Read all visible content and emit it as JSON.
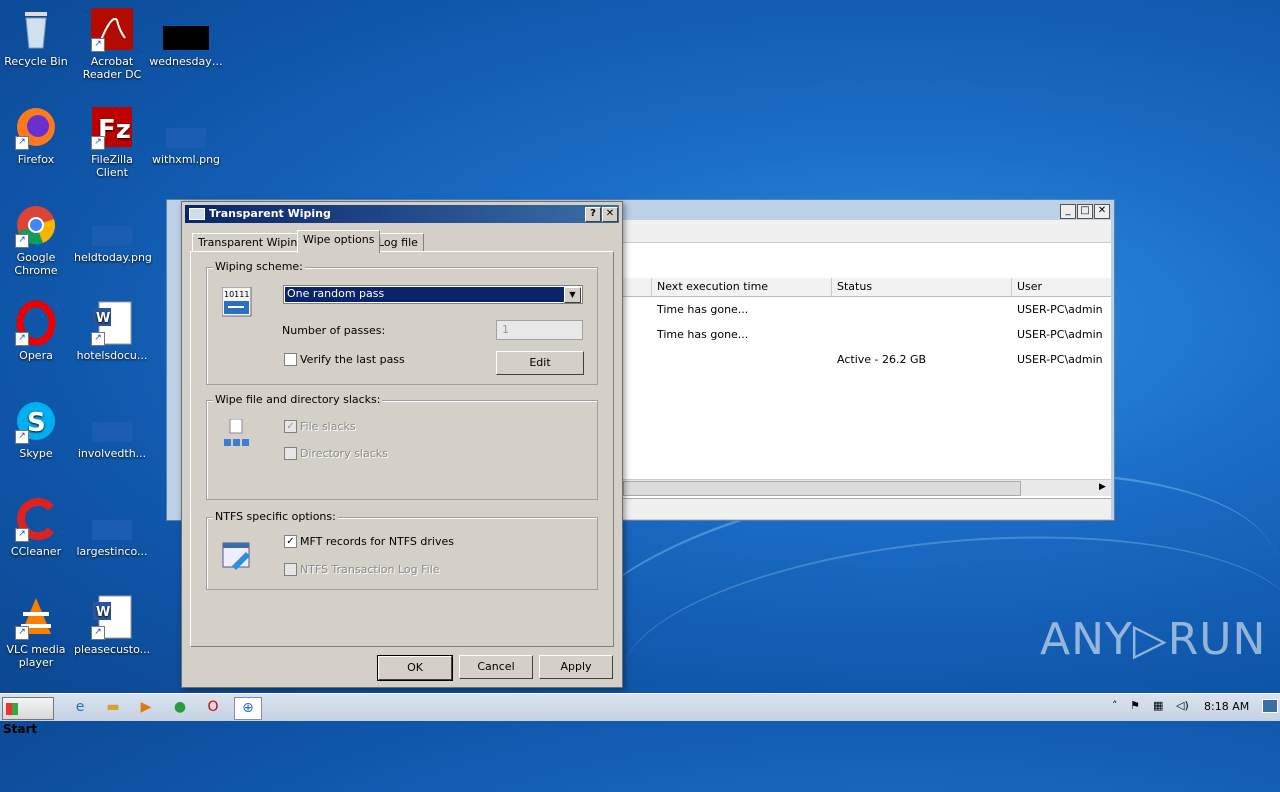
{
  "desktop": {
    "icons": [
      {
        "label": "Recycle Bin",
        "icon": "recycle-bin-icon"
      },
      {
        "label": "Acrobat Reader DC",
        "icon": "acrobat-icon"
      },
      {
        "label": "wednesday…",
        "icon": "file-icon"
      },
      {
        "label": "Firefox",
        "icon": "firefox-icon"
      },
      {
        "label": "FileZilla Client",
        "icon": "filezilla-icon"
      },
      {
        "label": "withxml.png",
        "icon": "image-file-icon"
      },
      {
        "label": "Google Chrome",
        "icon": "chrome-icon"
      },
      {
        "label": "heldtoday.png",
        "icon": "image-file-icon"
      },
      {
        "label": "Opera",
        "icon": "opera-icon"
      },
      {
        "label": "hotelsdocu...",
        "icon": "word-doc-icon"
      },
      {
        "label": "Skype",
        "icon": "skype-icon"
      },
      {
        "label": "involvedth...",
        "icon": "image-file-icon"
      },
      {
        "label": "CCleaner",
        "icon": "ccleaner-icon"
      },
      {
        "label": "largestinco...",
        "icon": "image-file-icon"
      },
      {
        "label": "VLC media player",
        "icon": "vlc-icon"
      },
      {
        "label": "pleasecusto...",
        "icon": "word-doc-icon"
      }
    ]
  },
  "bg_window": {
    "columns": [
      "Next execution time",
      "Status",
      "User"
    ],
    "rows": [
      {
        "next": "Time has gone...",
        "status": "",
        "user": "USER-PC\\admin"
      },
      {
        "next": "Time has gone...",
        "status": "",
        "user": "USER-PC\\admin"
      },
      {
        "next": "",
        "status": "Active - 26.2 GB",
        "user": "USER-PC\\admin"
      }
    ]
  },
  "dialog": {
    "title": "Transparent Wiping",
    "help_btn": "?",
    "close_btn": "✕",
    "tabs": [
      "Transparent Wiping",
      "Wipe options",
      "Log file"
    ],
    "active_tab": "Wipe options",
    "wiping_scheme": {
      "legend": "Wiping scheme:",
      "scheme_value": "One random pass",
      "passes_label": "Number of passes:",
      "passes_value": "1",
      "verify_label": "Verify the last pass",
      "verify_checked": false,
      "edit_label": "Edit",
      "icon_text": "10111"
    },
    "slacks": {
      "legend": "Wipe file and directory slacks:",
      "file_slacks": "File slacks",
      "file_slacks_checked": true,
      "dir_slacks": "Directory slacks",
      "dir_slacks_checked": false
    },
    "ntfs": {
      "legend": "NTFS specific options:",
      "mft": "MFT records for NTFS drives",
      "mft_checked": true,
      "log": "NTFS Transaction Log File",
      "log_checked": false
    },
    "buttons": {
      "ok": "OK",
      "cancel": "Cancel",
      "apply": "Apply"
    }
  },
  "taskbar": {
    "start": "Start",
    "clock": "8:18 AM"
  },
  "watermark": "ANY▷RUN"
}
